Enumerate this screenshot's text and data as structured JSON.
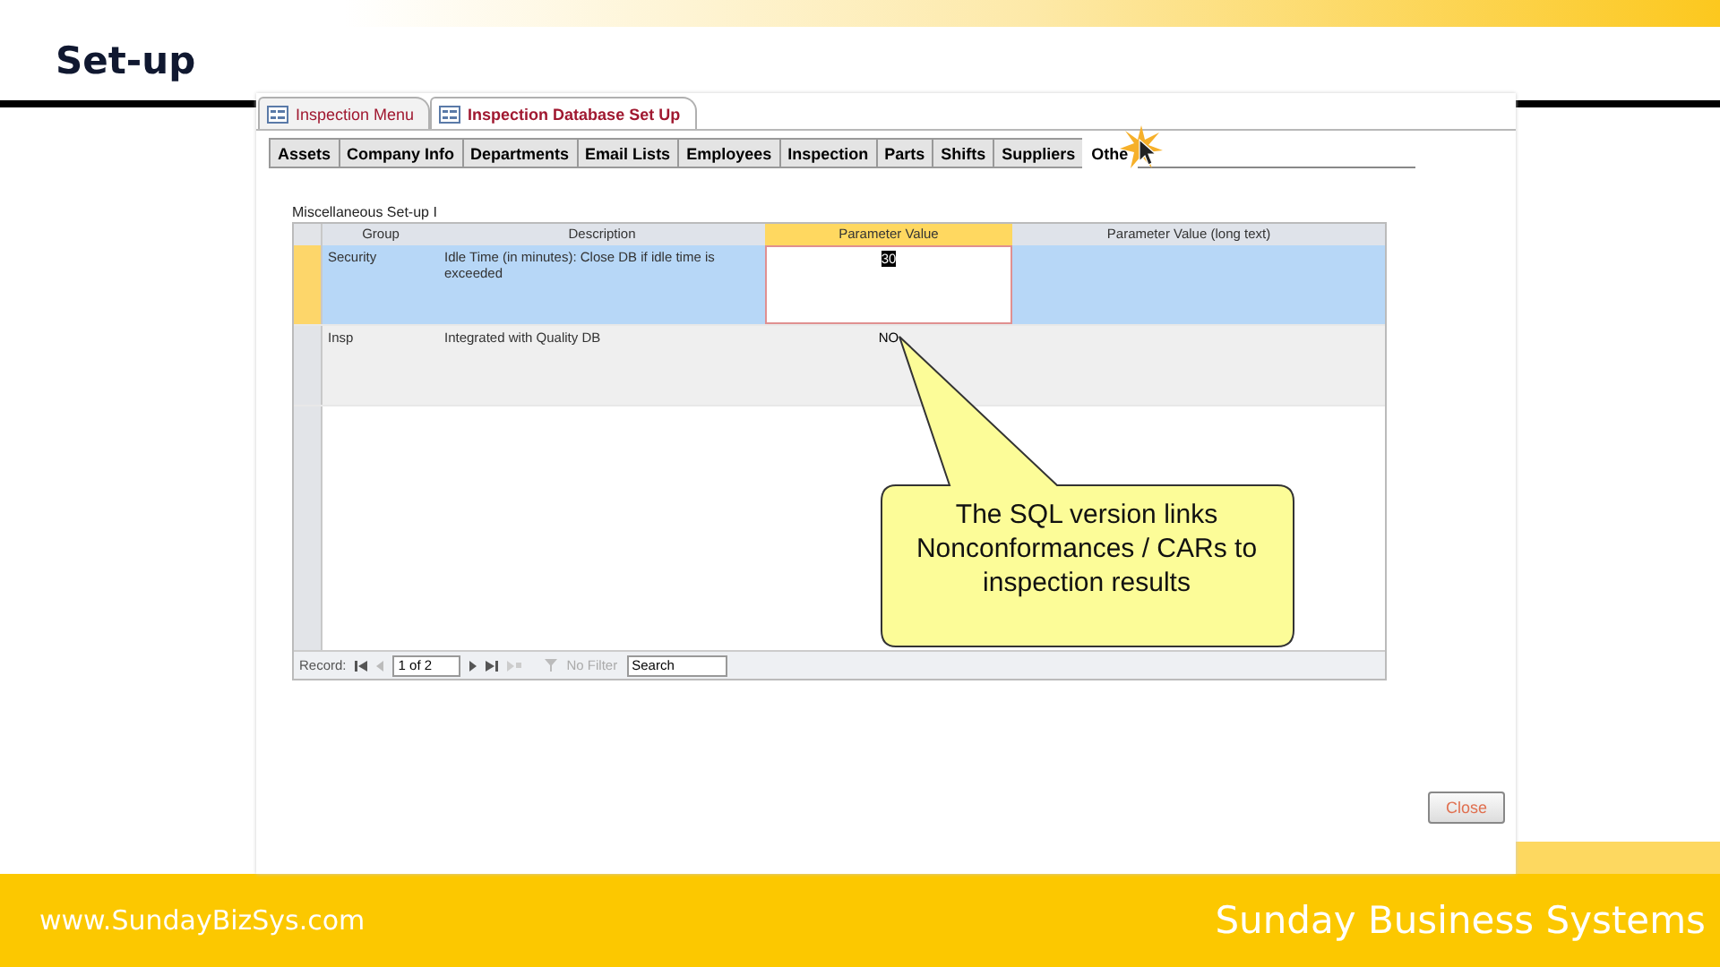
{
  "slide": {
    "title": "Set-up",
    "footer_left": "www.SundayBizSys.com",
    "footer_right": "Sunday Business Systems"
  },
  "window": {
    "doc_tabs": [
      {
        "label": "Inspection Menu",
        "selected": false
      },
      {
        "label": "Inspection Database Set Up",
        "selected": true
      }
    ],
    "form_tabs": [
      {
        "label": "Assets",
        "selected": false
      },
      {
        "label": "Company Info",
        "selected": false
      },
      {
        "label": "Departments",
        "selected": false
      },
      {
        "label": "Email Lists",
        "selected": false
      },
      {
        "label": "Employees",
        "selected": false
      },
      {
        "label": "Inspection",
        "selected": false
      },
      {
        "label": "Parts",
        "selected": false
      },
      {
        "label": "Shifts",
        "selected": false
      },
      {
        "label": "Suppliers",
        "selected": false
      },
      {
        "label": "Othe",
        "selected": true
      }
    ],
    "caption": "Miscellaneous Set-up I",
    "table": {
      "columns": [
        {
          "label": "Group",
          "selected": false
        },
        {
          "label": "Description",
          "selected": false
        },
        {
          "label": "Parameter Value",
          "selected": true
        },
        {
          "label": "Parameter Value (long text)",
          "selected": false
        }
      ],
      "rows": [
        {
          "selected": true,
          "group": "Security",
          "description": "Idle Time (in minutes): Close DB if idle time is exceeded",
          "value": "30"
        },
        {
          "selected": false,
          "group": "Insp",
          "description": "Integrated with Quality DB",
          "value": "NO"
        }
      ]
    },
    "navigator": {
      "label": "Record:",
      "position": "1 of 2",
      "filter": "No Filter",
      "search_placeholder": "Search"
    },
    "close_button": "Close",
    "callout": "The SQL version links Nonconformances / CARs to inspection results"
  }
}
